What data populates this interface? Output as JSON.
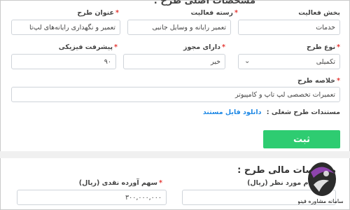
{
  "top_section": {
    "title": "مشخصات اصلی طرح :"
  },
  "fields": {
    "sector": {
      "label": "بخش فعالیت",
      "value": "خدمات"
    },
    "category": {
      "label": "رسته فعالیت",
      "value": "تعمیر رایانه و وسایل جانبی"
    },
    "plan_title": {
      "label": "عنوان طرح",
      "value": "تعمیر و نگهداری رایانه‌های لپ‌تا"
    },
    "plan_type": {
      "label": "نوع طرح",
      "value": "تکمیلی"
    },
    "license": {
      "label": "دارای مجوز",
      "value": "خیر"
    },
    "progress": {
      "label": "پیشرفت فیزیکی",
      "value": "۹۰"
    },
    "summary": {
      "label": "خلاصه طرح",
      "value": "تعمیرات تخصصی لپ تاپ و کامپیوتر"
    }
  },
  "documents": {
    "label": "مستندات طرح شغلی :",
    "link": "دانلود فایل مستند"
  },
  "submit_label": "ثبت",
  "bottom_section": {
    "title": "مشخصات مالی طرح :",
    "amount_label": "مبلغ وام مورد نظر (ریال)",
    "cash_label": "سهم آورده نقدی (ریال)",
    "cash_value": "۳۰۰,۰۰۰,۰۰۰"
  },
  "logo": {
    "text": "سامانه مشاوره فینو"
  },
  "required_mark": "*",
  "colors": {
    "accent_green": "#2ecc71",
    "link_blue": "#1e88e5",
    "required_red": "#e53935"
  }
}
